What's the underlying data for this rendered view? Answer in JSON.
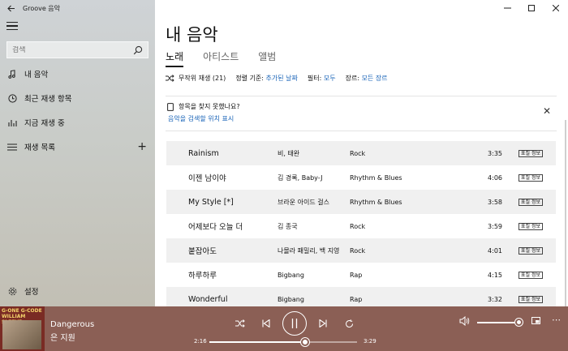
{
  "app": {
    "title": "Groove 음악"
  },
  "search": {
    "placeholder": "검색"
  },
  "nav": {
    "my_music": "내 음악",
    "recent": "최근 재생 항목",
    "now_playing": "지금 재생 중",
    "playlists": "재생 목록",
    "add": "+",
    "settings": "설정"
  },
  "main": {
    "title": "내 음악",
    "tabs": [
      {
        "label": "노래"
      },
      {
        "label": "아티스트"
      },
      {
        "label": "앨범"
      }
    ],
    "filter_bar": {
      "shuffle": "무작위 재생 (21)",
      "sort_label": "정렬 기준:",
      "sort_value": "추가된 날짜",
      "filter_label": "필터:",
      "filter_value": "모두",
      "genre_label": "장르:",
      "genre_value": "모든 장르"
    },
    "notice": {
      "title": "항목을 찾지 못했나요?",
      "link": "음악을 검색할 위치 표시",
      "close": "✕"
    },
    "songs": [
      {
        "title": "Rainism",
        "artist": "비, 태완",
        "genre": "Rock",
        "duration": "3:35",
        "badge": "표칠 정보"
      },
      {
        "title": "이젠 남이야",
        "artist": "김 경록, Baby-J",
        "genre": "Rhythm & Blues",
        "duration": "4:06",
        "badge": "표칠 정보"
      },
      {
        "title": "My Style [*]",
        "artist": "브라운 아이드 걸스",
        "genre": "Rhythm & Blues",
        "duration": "3:58",
        "badge": "표칠 정보"
      },
      {
        "title": "어제보다 오늘 더",
        "artist": "김 종국",
        "genre": "Rock",
        "duration": "3:59",
        "badge": "표칠 정보"
      },
      {
        "title": "붙잡아도",
        "artist": "나몰라 패밀리, 백 지영",
        "genre": "Rock",
        "duration": "4:01",
        "badge": "표칠 정보"
      },
      {
        "title": "하루하루",
        "artist": "Bigbang",
        "genre": "Rap",
        "duration": "4:15",
        "badge": "표칠 정보"
      },
      {
        "title": "Wonderful",
        "artist": "Bigbang",
        "genre": "Rap",
        "duration": "3:32",
        "badge": "표칠 정보"
      }
    ]
  },
  "player": {
    "album_art_text": "G-ONE G-CODE WILLIAM SLEEVE",
    "track_title": "Dangerous",
    "track_artist": "은 지원",
    "time_current": "2:16",
    "time_total": "3:29",
    "progress_fraction": 0.65,
    "volume_fraction": 1.0
  },
  "colors": {
    "accent": "#1a64b8",
    "player_bg": "#8b5f55"
  }
}
